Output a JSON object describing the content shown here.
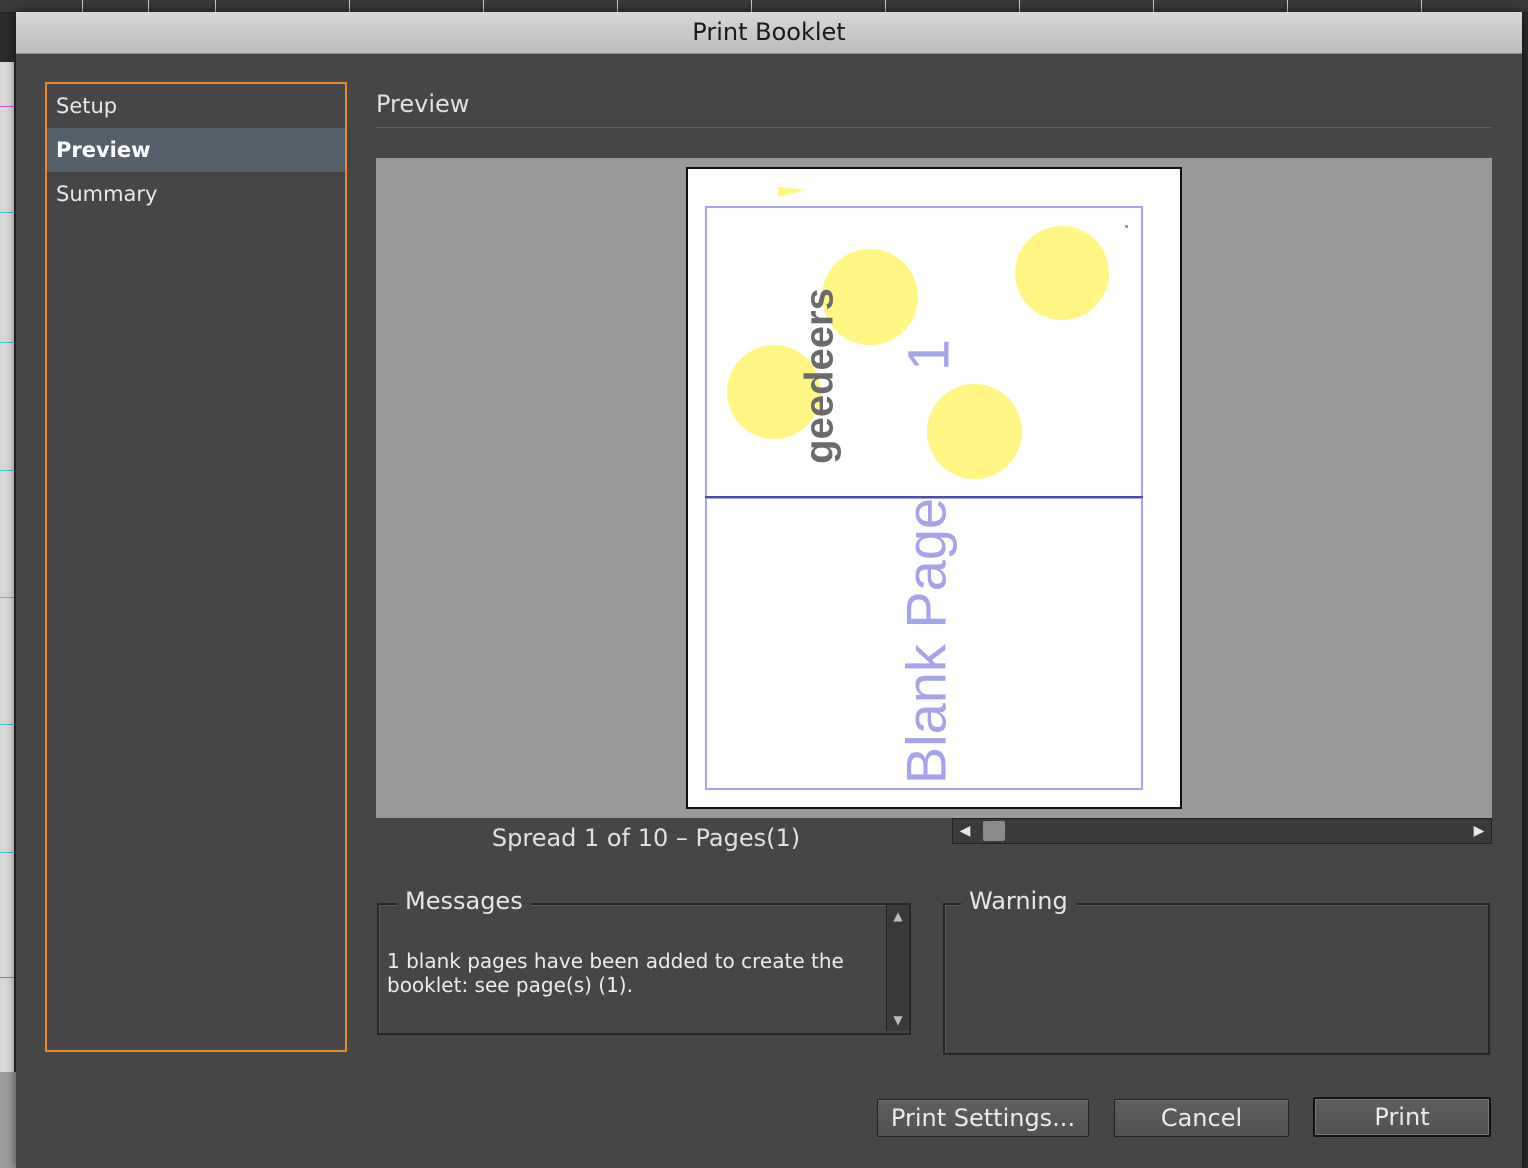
{
  "dialog": {
    "title": "Print Booklet"
  },
  "sidebar": {
    "items": [
      {
        "label": "Setup",
        "active": false
      },
      {
        "label": "Preview",
        "active": true
      },
      {
        "label": "Summary",
        "active": false
      }
    ]
  },
  "preview": {
    "heading": "Preview",
    "sheet": {
      "top_page_text": "geedeers",
      "top_page_number": "1",
      "bottom_page_text": "Blank Page"
    },
    "spread_label": "Spread 1 of 10 – Pages(1)",
    "scroll": {
      "left_arrow": "◀",
      "right_arrow": "▶"
    }
  },
  "messages": {
    "legend": "Messages",
    "text": "1 blank pages have been added to create the booklet: see page(s) (1).",
    "scroll_up": "▲",
    "scroll_down": "▼"
  },
  "warning": {
    "legend": "Warning",
    "text": ""
  },
  "buttons": {
    "print_settings": "Print Settings...",
    "cancel": "Cancel",
    "print": "Print"
  },
  "colors": {
    "accent_focus": "#e8892f",
    "page_frame": "#a5a3ea",
    "circle_fill": "#fff683"
  }
}
